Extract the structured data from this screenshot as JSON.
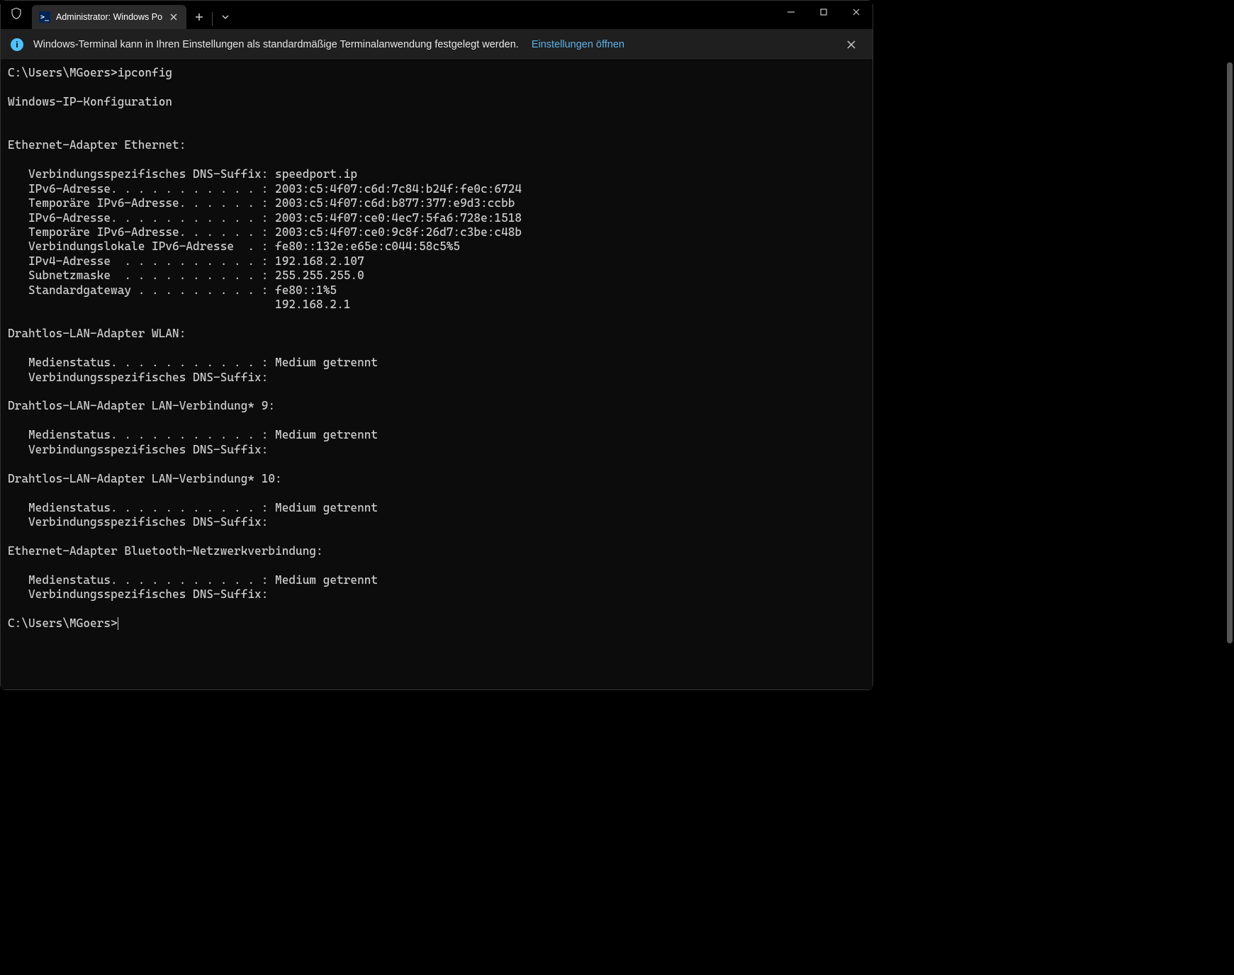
{
  "titlebar": {
    "tab_title": "Administrator: Windows Po"
  },
  "infobar": {
    "text": "Windows-Terminal kann in Ihren Einstellungen als standardmäßige Terminalanwendung festgelegt werden.",
    "link": "Einstellungen öffnen"
  },
  "terminal": {
    "prompt1": "C:\\Users\\MGoers>",
    "command1": "ipconfig",
    "header": "Windows-IP-Konfiguration",
    "adapters": [
      {
        "title": "Ethernet-Adapter Ethernet:",
        "lines": [
          "   Verbindungsspezifisches DNS-Suffix: speedport.ip",
          "   IPv6-Adresse. . . . . . . . . . . : 2003:c5:4f07:c6d:7c84:b24f:fe0c:6724",
          "   Temporäre IPv6-Adresse. . . . . . : 2003:c5:4f07:c6d:b877:377:e9d3:ccbb",
          "   IPv6-Adresse. . . . . . . . . . . : 2003:c5:4f07:ce0:4ec7:5fa6:728e:1518",
          "   Temporäre IPv6-Adresse. . . . . . : 2003:c5:4f07:ce0:9c8f:26d7:c3be:c48b",
          "   Verbindungslokale IPv6-Adresse  . : fe80::132e:e65e:c044:58c5%5",
          "   IPv4-Adresse  . . . . . . . . . . : 192.168.2.107",
          "   Subnetzmaske  . . . . . . . . . . : 255.255.255.0",
          "   Standardgateway . . . . . . . . . : fe80::1%5",
          "                                       192.168.2.1"
        ]
      },
      {
        "title": "Drahtlos-LAN-Adapter WLAN:",
        "lines": [
          "   Medienstatus. . . . . . . . . . . : Medium getrennt",
          "   Verbindungsspezifisches DNS-Suffix:"
        ]
      },
      {
        "title": "Drahtlos-LAN-Adapter LAN-Verbindung* 9:",
        "lines": [
          "   Medienstatus. . . . . . . . . . . : Medium getrennt",
          "   Verbindungsspezifisches DNS-Suffix:"
        ]
      },
      {
        "title": "Drahtlos-LAN-Adapter LAN-Verbindung* 10:",
        "lines": [
          "   Medienstatus. . . . . . . . . . . : Medium getrennt",
          "   Verbindungsspezifisches DNS-Suffix:"
        ]
      },
      {
        "title": "Ethernet-Adapter Bluetooth-Netzwerkverbindung:",
        "lines": [
          "   Medienstatus. . . . . . . . . . . : Medium getrennt",
          "   Verbindungsspezifisches DNS-Suffix:"
        ]
      }
    ],
    "prompt2": "C:\\Users\\MGoers>"
  }
}
